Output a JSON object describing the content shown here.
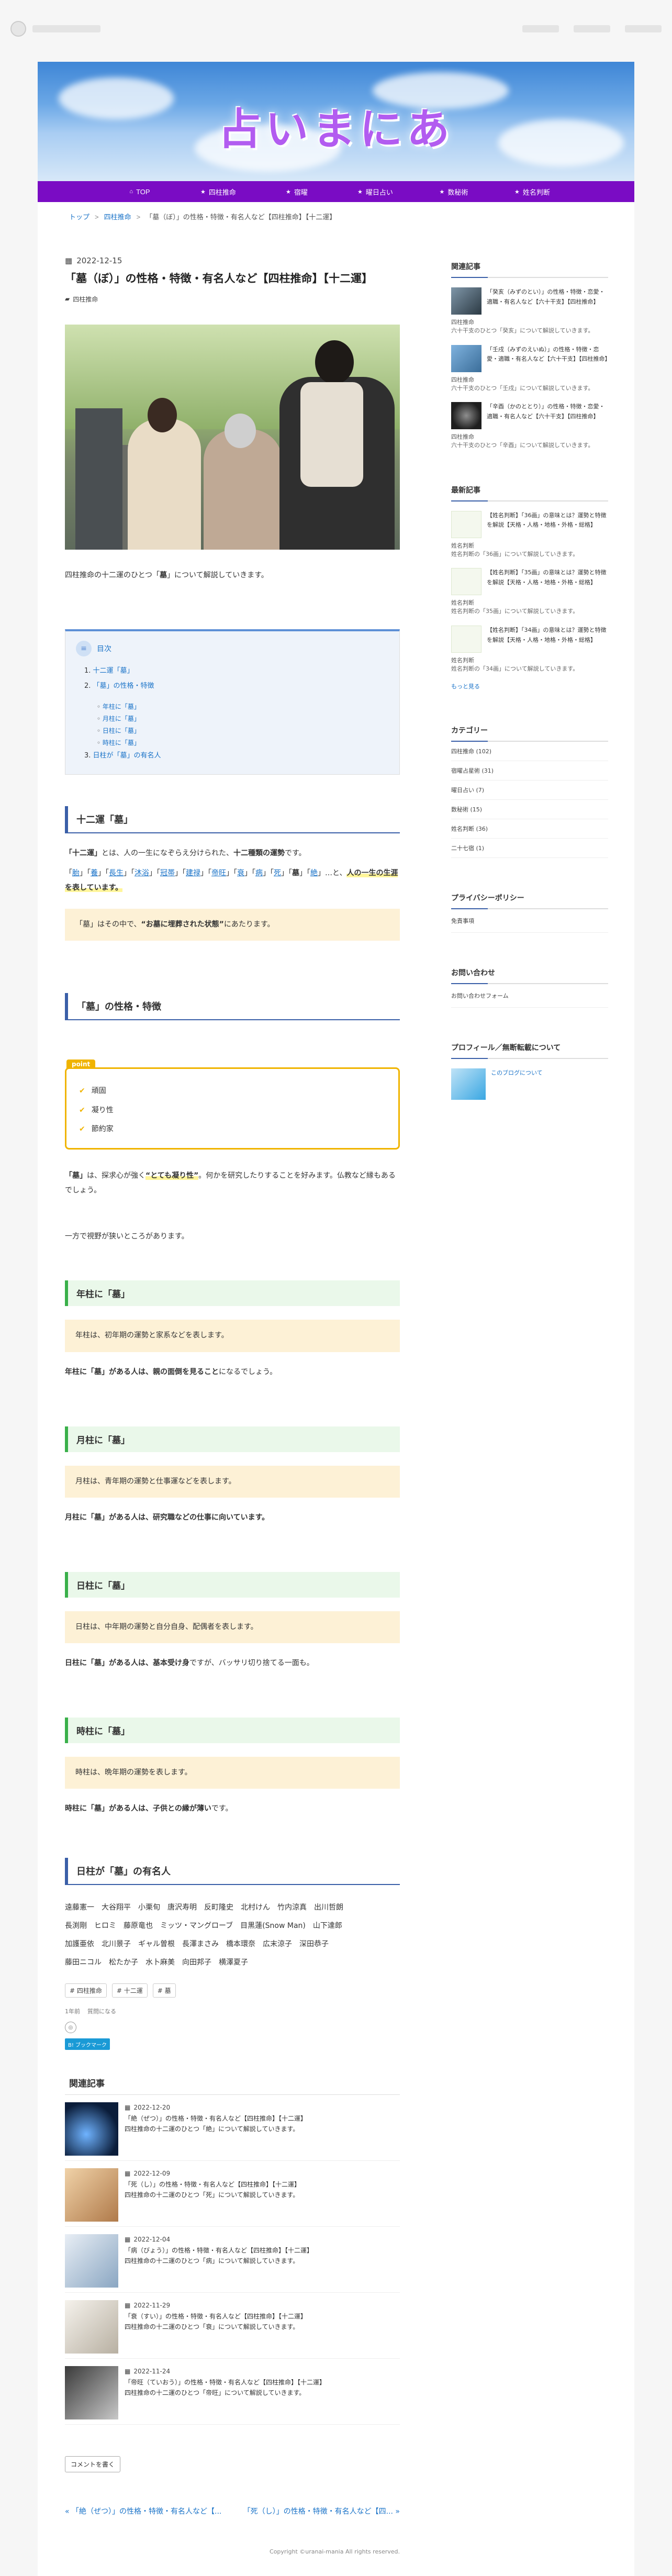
{
  "site": {
    "title": "占いまにあ",
    "nav": [
      {
        "label": "TOP",
        "icon": "home-icon"
      },
      {
        "label": "四柱推命",
        "icon": "star-icon"
      },
      {
        "label": "宿曜",
        "icon": "star-icon"
      },
      {
        "label": "曜日占い",
        "icon": "star-icon"
      },
      {
        "label": "数秘術",
        "icon": "star-icon"
      },
      {
        "label": "姓名判断",
        "icon": "star-icon"
      }
    ]
  },
  "breadcrumb": {
    "items": [
      "トップ",
      "四柱推命",
      "「墓（ぼ）」の性格・特徴・有名人など【四柱推命】【十二運】"
    ]
  },
  "article": {
    "date": "2022-12-15",
    "title": "「墓（ぼ）」の性格・特徴・有名人など【四柱推命】【十二運】",
    "category": "四柱推命",
    "lead_pre": "四柱推命の十二運のひとつ「",
    "lead_bold": "墓",
    "lead_post": "」について解説していきます。",
    "toc": {
      "title": "目次",
      "items": [
        {
          "no": "1.",
          "label": "十二運「墓」"
        },
        {
          "no": "2.",
          "label": "「墓」の性格・特徴",
          "children": [
            "年柱に「墓」",
            "月柱に「墓」",
            "日柱に「墓」",
            "時柱に「墓」"
          ]
        },
        {
          "no": "3.",
          "label": "日柱が「墓」の有名人"
        }
      ]
    },
    "sec1": {
      "heading": "十二運「墓」",
      "p1_a": "「十二運」",
      "p1_b": "とは、人の一生になぞらえ分けられた、",
      "p1_c": "十二種類の運勢",
      "p1_d": "です。",
      "twelve": [
        "胎",
        "養",
        "長生",
        "沐浴",
        "冠帯",
        "建禄",
        "帝旺",
        "衰",
        "病",
        "死",
        "墓",
        "絶"
      ],
      "p2_tail": "…と、",
      "p2_hl": "人の一生の生涯を表しています。",
      "box_a": "「墓」はその中で、",
      "box_b": "“お墓に埋葬された状態”",
      "box_c": "にあたります。"
    },
    "sec2": {
      "heading": "「墓」の性格・特徴",
      "point_label": "point",
      "points": [
        "頑固",
        "凝り性",
        "節約家"
      ],
      "p1_a": "「墓」",
      "p1_b": "は、探求心が強く",
      "p1_c": "“とても凝り性”",
      "p1_d": "。何かを研究したりすることを好みます。仏教など縁もあるでしょう。",
      "p2": "一方で視野が狭いところがあります。"
    },
    "pillars": [
      {
        "heading": "年柱に「墓」",
        "box": "年柱は、初年期の運勢と家系などを表します。",
        "pre": "年柱に「墓」がある人は、",
        "bold": "親の面倒を見ること",
        "post": "になるでしょう。"
      },
      {
        "heading": "月柱に「墓」",
        "box": "月柱は、青年期の運勢と仕事運などを表します。",
        "pre": "月柱に「墓」がある人は、",
        "bold": "研究職などの仕事に向いています。",
        "post": ""
      },
      {
        "heading": "日柱に「墓」",
        "box": "日柱は、中年期の運勢と自分自身、配偶者を表します。",
        "pre": "日柱に「墓」がある人は、",
        "bold": "基本受け身",
        "post": "ですが、バッサリ切り捨てる一面も。"
      },
      {
        "heading": "時柱に「墓」",
        "box": "時柱は、晩年期の運勢を表します。",
        "pre": "時柱に「墓」がある人は、",
        "bold": "子供との縁が薄い",
        "post": "です。"
      }
    ],
    "sec3": {
      "heading": "日柱が「墓」の有名人",
      "people": [
        "遠藤憲一",
        "大谷翔平",
        "小栗旬",
        "唐沢寿明",
        "反町隆史",
        "北村けん",
        "竹内涼真",
        "出川哲朗",
        "長渕剛",
        "ヒロミ",
        "藤原竜也",
        "ミッツ・マングローブ",
        "目黒蓮(Snow Man)",
        "山下達郎",
        "加護亜依",
        "北川景子",
        "ギャル曽根",
        "長澤まさみ",
        "橋本環奈",
        "広末涼子",
        "深田恭子",
        "藤田ニコル",
        "松たか子",
        "水卜麻美",
        "向田邦子",
        "横澤夏子"
      ]
    },
    "tags": [
      "四柱推命",
      "十二運",
      "墓"
    ],
    "small_links": [
      "1年前",
      "質問になる"
    ],
    "bookmark": "B! ブックマーク",
    "related": {
      "title": "関連記事",
      "items": [
        {
          "date": "2022-12-20",
          "title": "「絶（ぜつ）」の性格・特徴・有名人など【四柱推命】【十二運】",
          "desc": "四柱推命の十二運のひとつ「絶」について解説していきます。"
        },
        {
          "date": "2022-12-09",
          "title": "「死（し）」の性格・特徴・有名人など【四柱推命】【十二運】",
          "desc": "四柱推命の十二運のひとつ「死」について解説していきます。"
        },
        {
          "date": "2022-12-04",
          "title": "「病（びょう）」の性格・特徴・有名人など【四柱推命】【十二運】",
          "desc": "四柱推命の十二運のひとつ「病」について解説していきます。"
        },
        {
          "date": "2022-11-29",
          "title": "「衰（すい）」の性格・特徴・有名人など【四柱推命】【十二運】",
          "desc": "四柱推命の十二運のひとつ「衰」について解説していきます。"
        },
        {
          "date": "2022-11-24",
          "title": "「帝旺（ていおう）」の性格・特徴・有名人など【四柱推命】【十二運】",
          "desc": "四柱推命の十二運のひとつ「帝旺」について解説していきます。"
        }
      ]
    },
    "comment_button": "コメントを書く",
    "prev": "« 「絶（ぜつ）」の性格・特徴・有名人など【...",
    "next": "「死（し）」の性格・特徴・有名人など【四... »",
    "copyright": "Copyright ©uranai-mania All rights reserved."
  },
  "sidebar": {
    "related": {
      "title": "関連記事",
      "items": [
        {
          "title": "「癸亥（みずのとい）」の性格・特徴・恋愛・適職・有名人など【六十干支】【四柱推命】",
          "cat": "四柱推命",
          "desc": "六十干支のひとつ「癸亥」について解説していきます。"
        },
        {
          "title": "「壬戌（みずのえいぬ）」の性格・特徴・恋愛・適職・有名人など【六十干支】【四柱推命】",
          "cat": "四柱推命",
          "desc": "六十干支のひとつ「壬戌」について解説していきます。"
        },
        {
          "title": "「辛酉（かのととり）」の性格・特徴・恋愛・適職・有名人など【六十干支】【四柱推命】",
          "cat": "四柱推命",
          "desc": "六十干支のひとつ「辛酉」について解説していきます。"
        }
      ]
    },
    "latest": {
      "title": "最新記事",
      "items": [
        {
          "title": "【姓名判断】「36画」の意味とは？運勢と特徴を解説【天格・人格・地格・外格・総格】",
          "cat": "姓名判断",
          "desc": "姓名判断の「36画」について解説していきます。"
        },
        {
          "title": "【姓名判断】「35画」の意味とは？運勢と特徴を解説【天格・人格・地格・外格・総格】",
          "cat": "姓名判断",
          "desc": "姓名判断の「35画」について解説していきます。"
        },
        {
          "title": "【姓名判断】「34画」の意味とは？運勢と特徴を解説【天格・人格・地格・外格・総格】",
          "cat": "姓名判断",
          "desc": "姓名判断の「34画」について解説していきます。"
        }
      ],
      "more": "もっと見る"
    },
    "categories": {
      "title": "カテゴリー",
      "items": [
        "四柱推命 (102)",
        "宿曜占星術 (31)",
        "曜日占い (7)",
        "数秘術 (15)",
        "姓名判断 (36)",
        "二十七宿 (1)"
      ]
    },
    "privacy": {
      "title": "プライバシーポリシー",
      "item": "免責事項"
    },
    "contact": {
      "title": "お問い合わせ",
      "item": "お問い合わせフォーム"
    },
    "profile": {
      "title": "プロフィール／無断転載について",
      "link": "このブログについて"
    }
  }
}
